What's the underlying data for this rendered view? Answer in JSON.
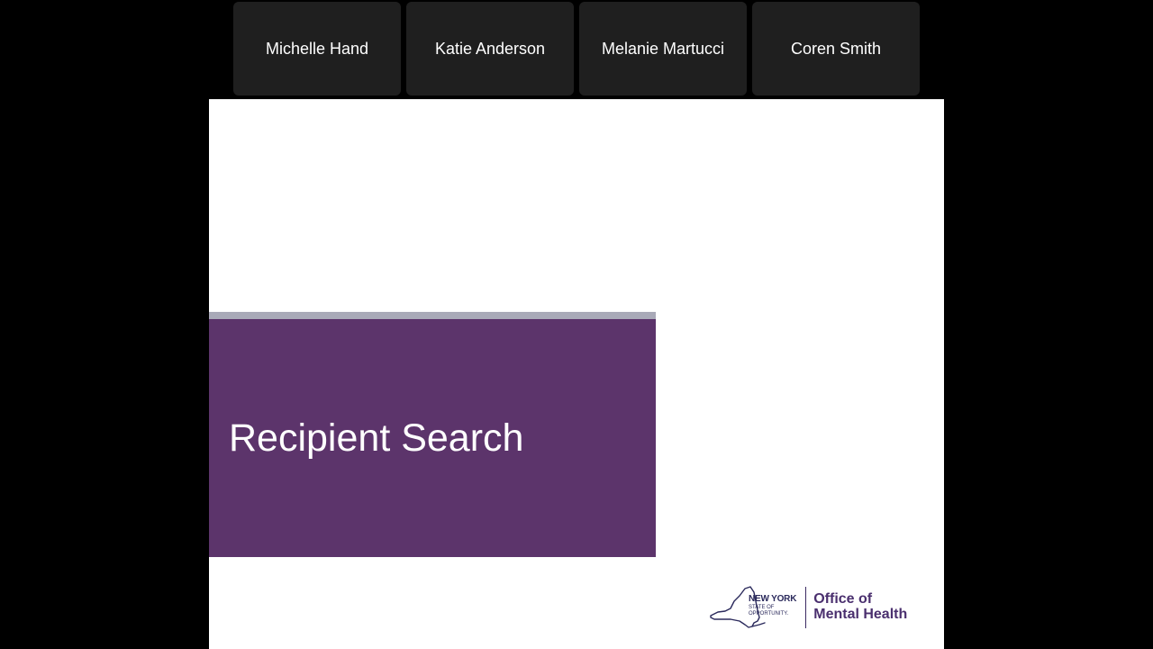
{
  "participants": [
    {
      "name": "Michelle Hand"
    },
    {
      "name": "Katie Anderson"
    },
    {
      "name": "Melanie Martucci"
    },
    {
      "name": "Coren Smith"
    }
  ],
  "slide": {
    "title": "Recipient Search",
    "title_block_color": "#5c346b",
    "accent_color": "#a9aab8"
  },
  "logo": {
    "state_line1": "NEW YORK",
    "state_line2": "STATE OF",
    "state_line3": "OPPORTUNITY.",
    "office_line1": "Office of",
    "office_line2": "Mental Health",
    "brand_color": "#4a2f6e"
  }
}
